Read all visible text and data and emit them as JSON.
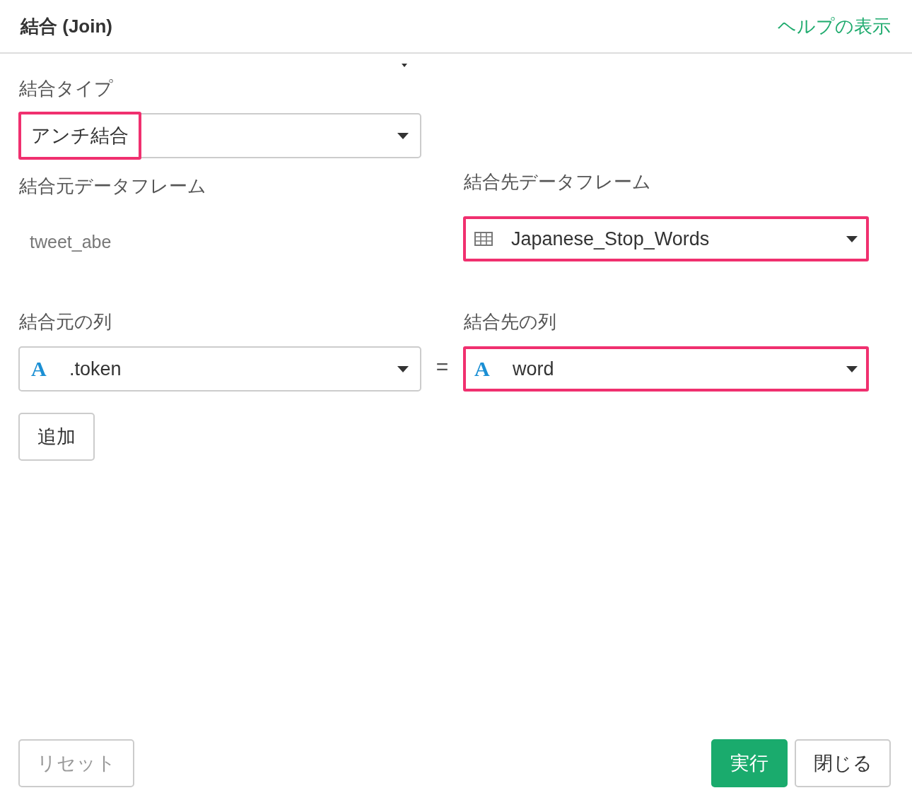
{
  "header": {
    "title": "結合 (Join)",
    "help_link": "ヘルプの表示"
  },
  "join_type": {
    "label": "結合タイプ",
    "value": "アンチ結合",
    "highlighted": true
  },
  "source_frame": {
    "label": "結合元データフレーム",
    "value": "tweet_abe"
  },
  "target_frame": {
    "label": "結合先データフレーム",
    "value": "Japanese_Stop_Words",
    "highlighted": true
  },
  "source_column": {
    "label": "結合元の列",
    "type_icon": "A",
    "value": ".token",
    "highlighted": false
  },
  "operator": "=",
  "target_column": {
    "label": "結合先の列",
    "type_icon": "A",
    "value": "word",
    "highlighted": true
  },
  "add_button": "追加",
  "footer": {
    "reset": "リセット",
    "run": "実行",
    "close": "閉じる"
  }
}
